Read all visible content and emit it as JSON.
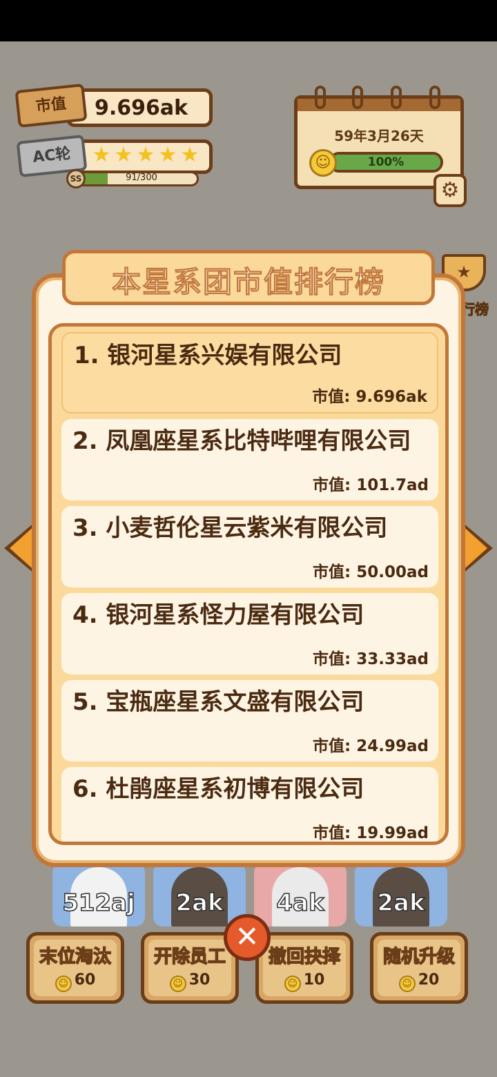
{
  "hud": {
    "market_value_tag": "市值",
    "market_value": "9.696ak",
    "ac_tag": "AC轮",
    "stars": [
      "★",
      "★",
      "★",
      "★",
      "★"
    ],
    "xp_badge": "SS",
    "xp_text": "91/300",
    "xp_fraction": 0.3
  },
  "calendar": {
    "date": "59年3月26天",
    "mood_percent_text": "100%",
    "mood_fraction": 1.0
  },
  "side": {
    "ranking_label": "行榜"
  },
  "modal": {
    "title": "本星系团市值排行榜",
    "rows": [
      {
        "name": "1. 银河星系兴娱有限公司",
        "value": "市值: 9.696ak"
      },
      {
        "name": "2. 凤凰座星系比特哔哩有限公司",
        "value": "市值: 101.7ad"
      },
      {
        "name": "3. 小麦哲伦星云紫米有限公司",
        "value": "市值: 50.00ad"
      },
      {
        "name": "4. 银河星系怪力屋有限公司",
        "value": "市值: 33.33ad"
      },
      {
        "name": "5. 宝瓶座星系文盛有限公司",
        "value": "市值: 24.99ad"
      },
      {
        "name": "6. 杜鹃座星系初博有限公司",
        "value": "市值: 19.99ad"
      }
    ]
  },
  "employees": [
    {
      "value": "512aj",
      "color": "#6a8fc4"
    },
    {
      "value": "2ak",
      "color": "#6a8fc4"
    },
    {
      "value": "4ak",
      "color": "#c98a8a"
    },
    {
      "value": "2ak",
      "color": "#6a8fc4"
    }
  ],
  "actions": [
    {
      "label": "末位淘汰",
      "cost": "60"
    },
    {
      "label": "开除员工",
      "cost": "30"
    },
    {
      "label": "撤回抉择",
      "cost": "10"
    },
    {
      "label": "随机升级",
      "cost": "20"
    }
  ]
}
